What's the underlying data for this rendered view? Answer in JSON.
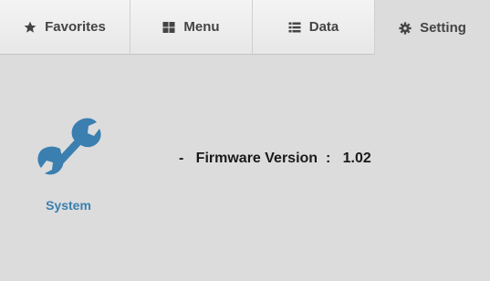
{
  "tabs": [
    {
      "label": "Favorites",
      "icon": "star-icon"
    },
    {
      "label": "Menu",
      "icon": "grid-icon"
    },
    {
      "label": "Data",
      "icon": "list-icon"
    },
    {
      "label": "Setting",
      "icon": "gear-icon"
    }
  ],
  "active_tab": "Setting",
  "system": {
    "label": "System",
    "icon": "wrench-icon",
    "icon_color": "#3b7fb0"
  },
  "firmware": {
    "bullet": "-",
    "label": "Firmware Version",
    "separator": ":",
    "value": "1.02"
  },
  "colors": {
    "background": "#dcdcdc",
    "accent": "#3b7fb0",
    "tab_text": "#444444"
  }
}
